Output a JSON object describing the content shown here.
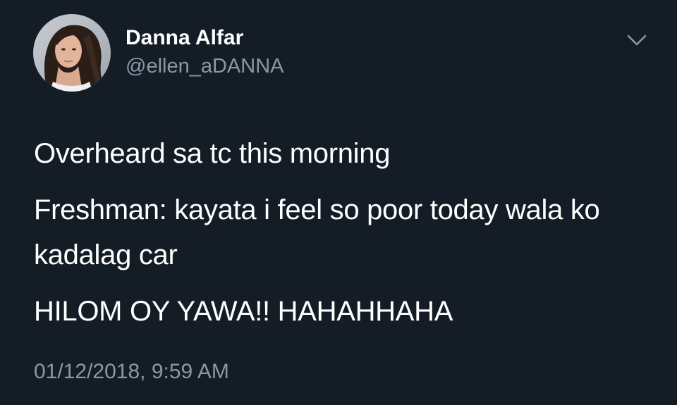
{
  "tweet": {
    "author": {
      "display_name": "Danna Alfar",
      "handle": "@ellen_aDANNA"
    },
    "paragraphs": [
      "Overheard sa tc this morning",
      "Freshman: kayata i feel so poor today wala ko kadalag car",
      "HILOM OY YAWA!! HAHAHHAHA"
    ],
    "timestamp": "01/12/2018, 9:59 AM",
    "icons": {
      "menu": "chevron-down-icon",
      "avatar": "avatar"
    }
  },
  "colors": {
    "background": "#141d26",
    "text_primary": "#ffffff",
    "text_secondary": "#8899a6"
  }
}
